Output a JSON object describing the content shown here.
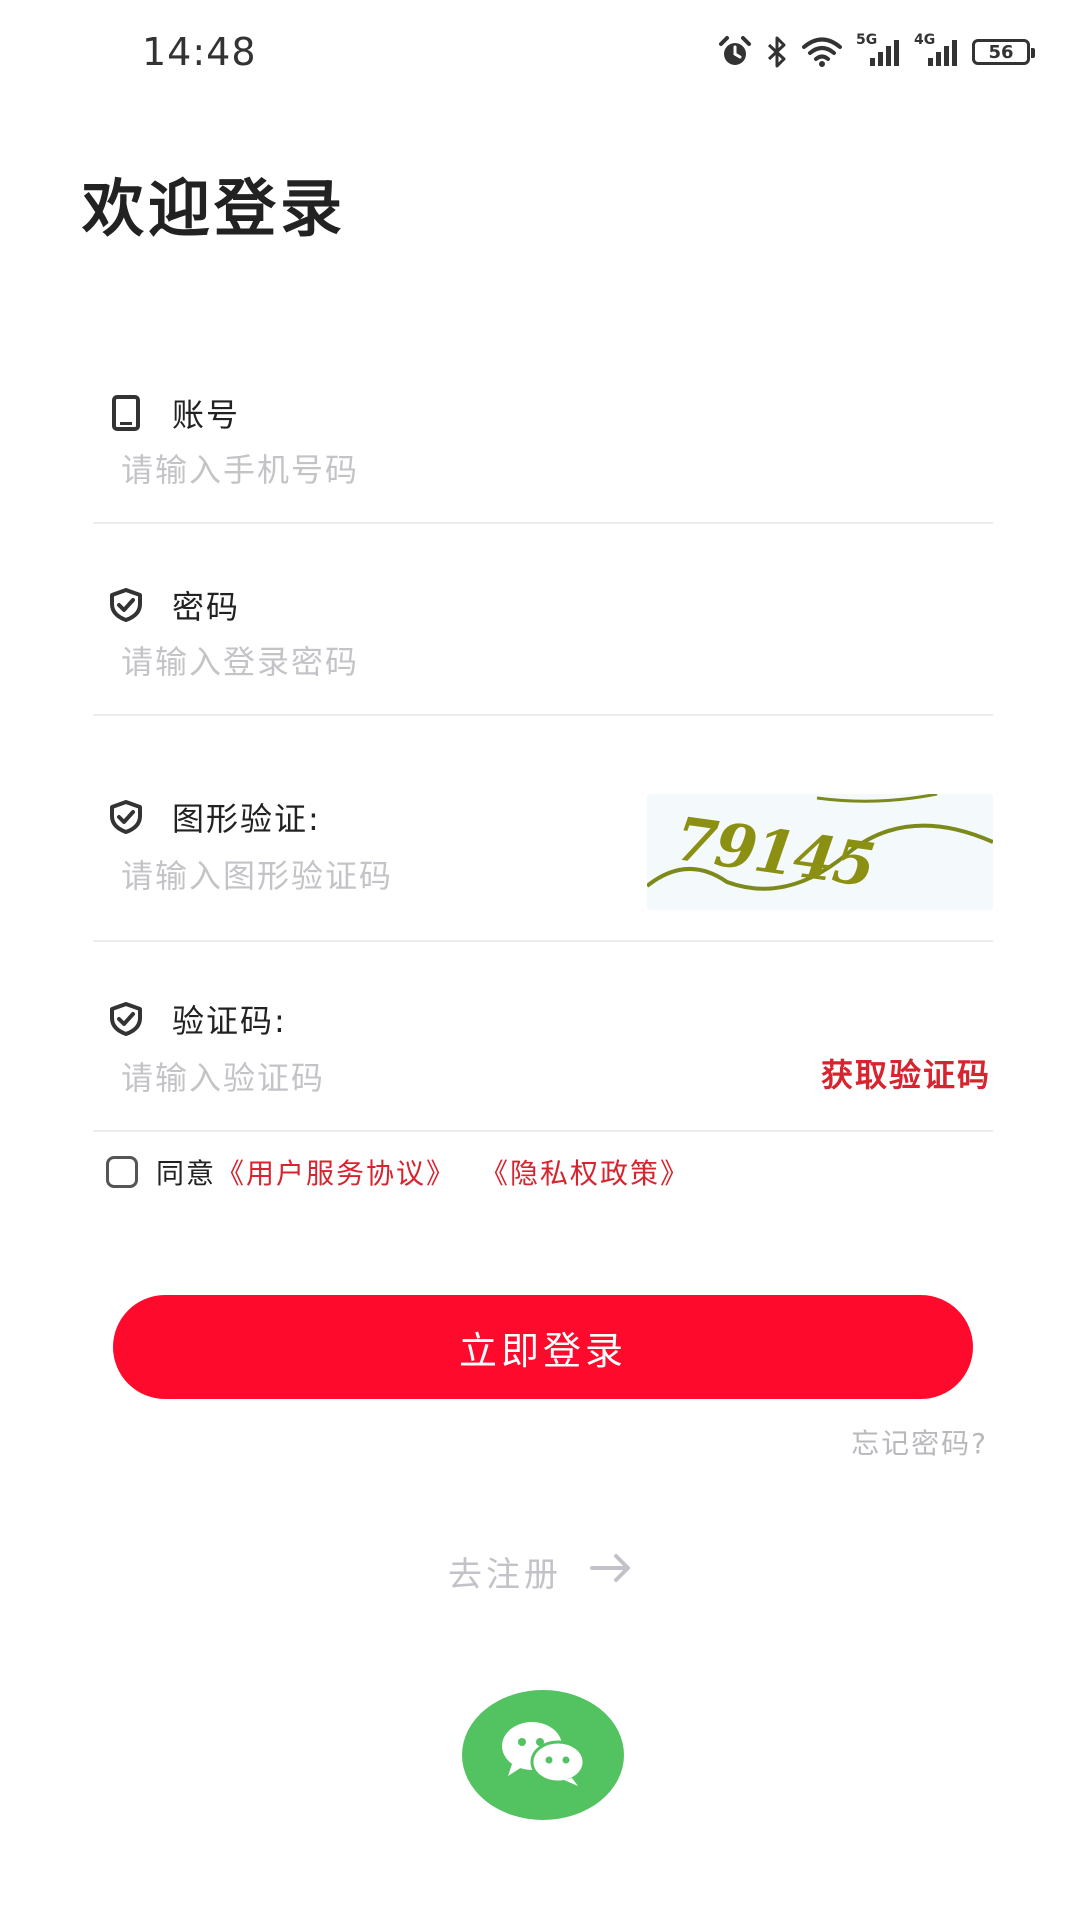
{
  "status_bar": {
    "time": "14:48",
    "network_1": "5G",
    "network_2": "4G",
    "battery": "56"
  },
  "title": "欢迎登录",
  "form": {
    "account": {
      "label": "账号",
      "placeholder": "请输入手机号码",
      "value": ""
    },
    "password": {
      "label": "密码",
      "placeholder": "请输入登录密码",
      "value": ""
    },
    "image_captcha": {
      "label": "图形验证:",
      "placeholder": "请输入图形验证码",
      "value": "",
      "image_text": "79145"
    },
    "sms_code": {
      "label": "验证码:",
      "placeholder": "请输入验证码",
      "value": "",
      "get_code_label": "获取验证码"
    }
  },
  "agreement": {
    "prefix": "同意",
    "terms_link": "《用户服务协议》",
    "privacy_link": "《隐私权政策》",
    "checked": false
  },
  "login_button": "立即登录",
  "forgot_password": "忘记密码?",
  "register": {
    "label": "去注册",
    "icon": "arrow-right-icon"
  },
  "wechat": {
    "icon": "wechat-icon"
  },
  "colors": {
    "accent_red": "#fd0a2c",
    "link_red": "#d8242f",
    "wechat_green": "#53c261",
    "placeholder_gray": "#c4c4c8"
  }
}
